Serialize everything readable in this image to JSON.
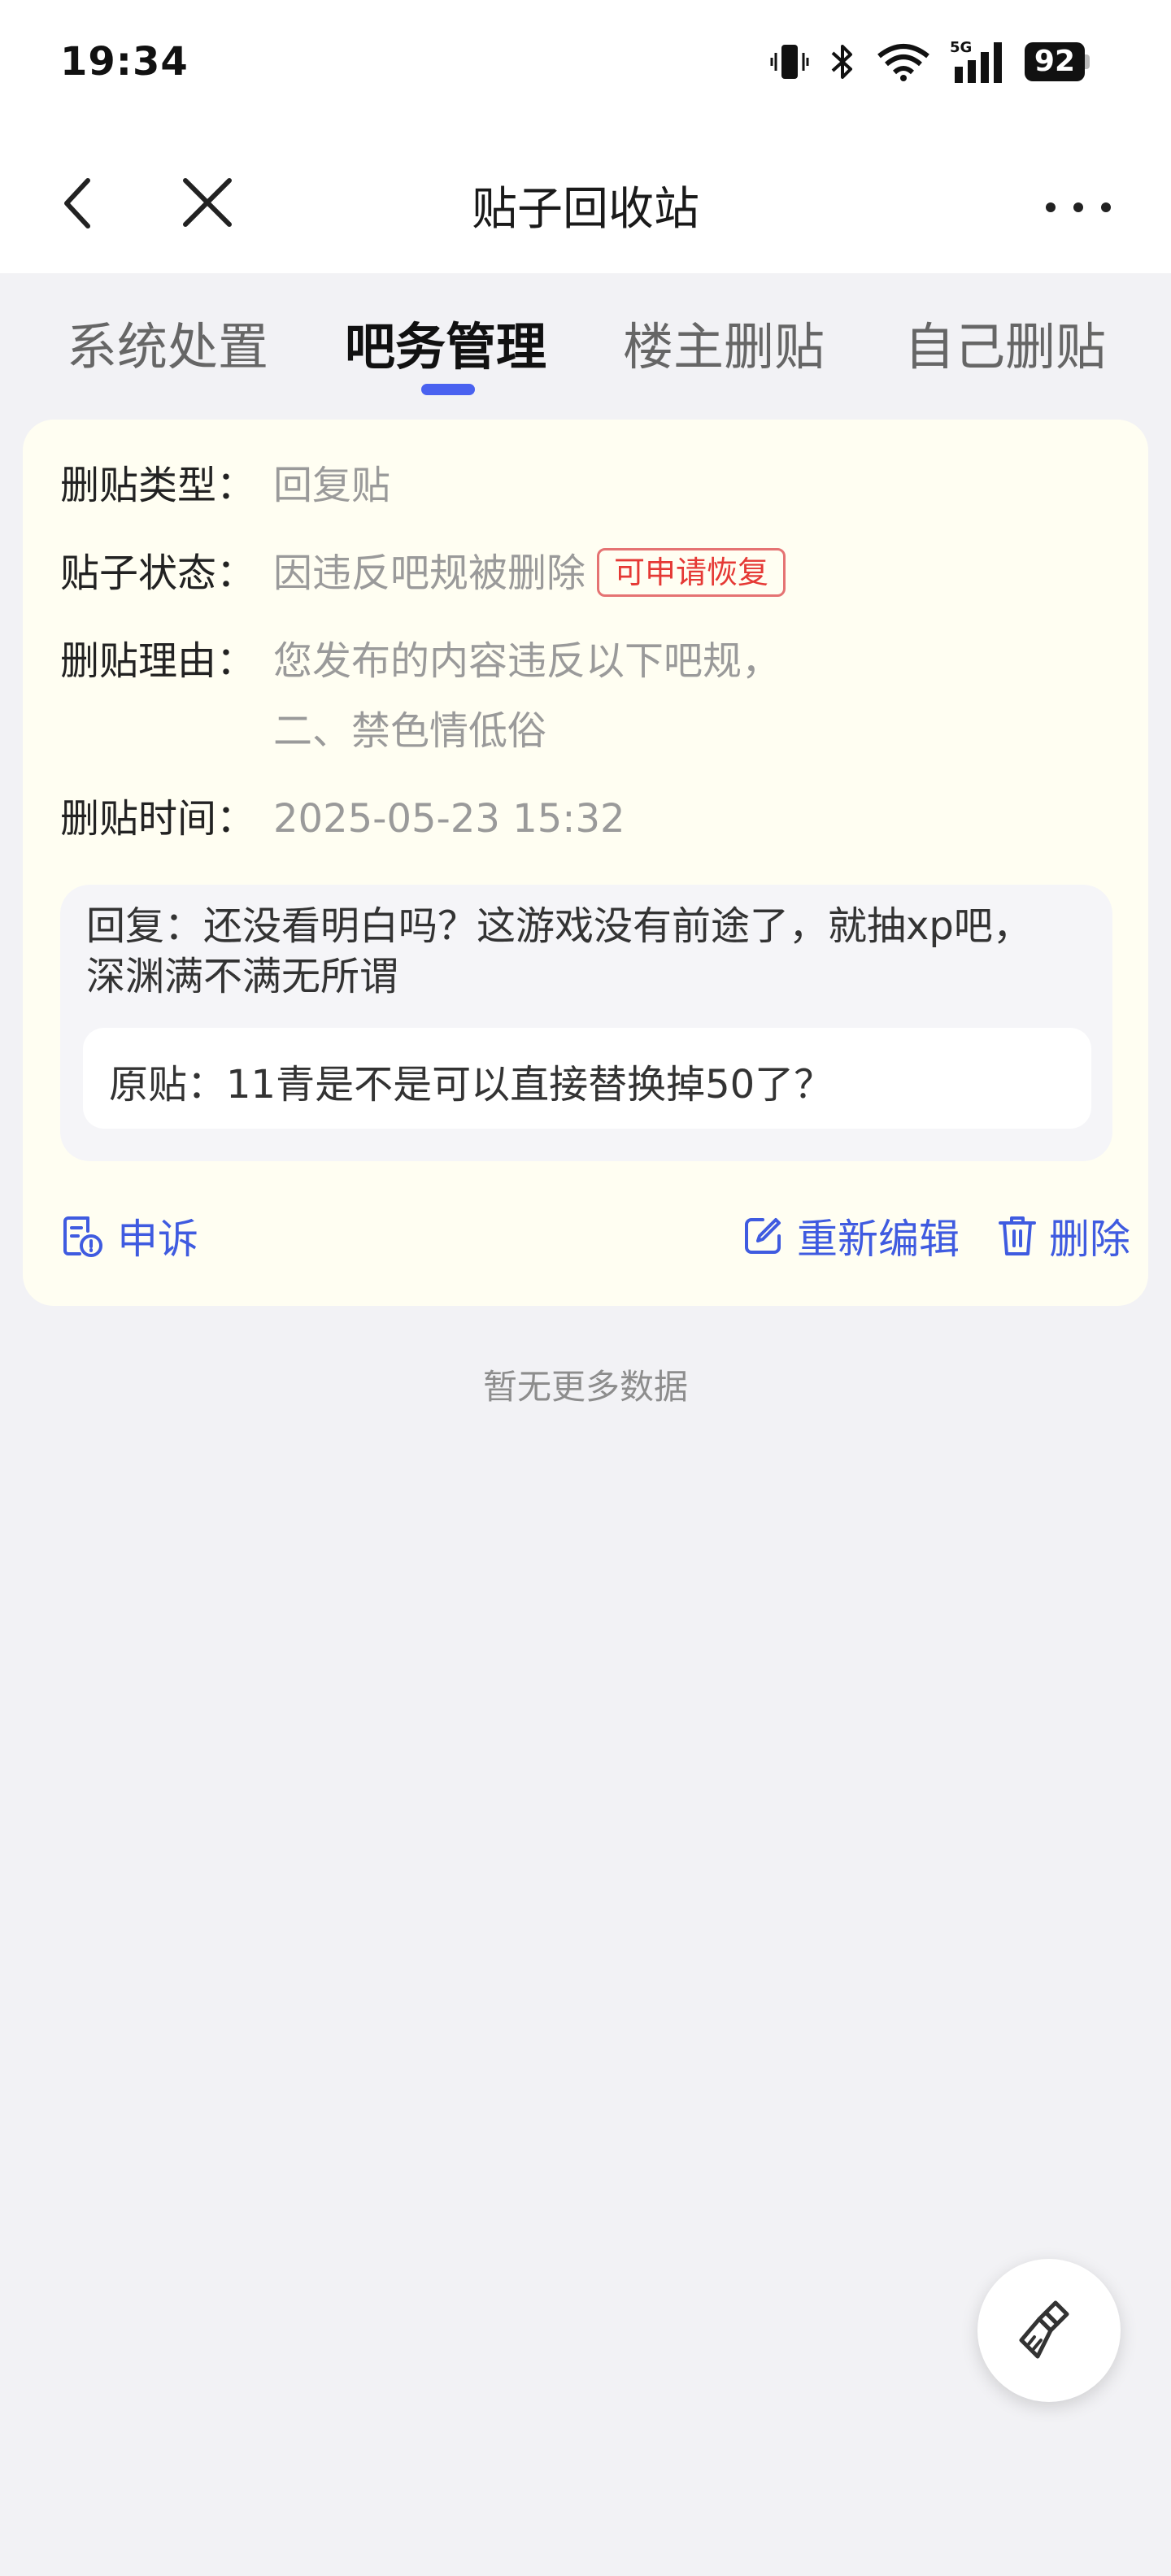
{
  "status_bar": {
    "time": "19:34",
    "battery": "92",
    "network": "5G"
  },
  "nav": {
    "title": "贴子回收站"
  },
  "tabs": [
    {
      "label": "系统处置"
    },
    {
      "label": "吧务管理"
    },
    {
      "label": "楼主删贴"
    },
    {
      "label": "自己删贴"
    }
  ],
  "active_tab": 1,
  "card": {
    "type_label": "删贴类型：",
    "type_value": "回复贴",
    "status_label": "贴子状态：",
    "status_value": "因违反吧规被删除",
    "status_badge": "可申请恢复",
    "reason_label": "删贴理由：",
    "reason_line1": "您发布的内容违反以下吧规，",
    "reason_line2": "二、禁色情低俗",
    "time_label": "删贴时间：",
    "time_value": "2025-05-23 15:32",
    "reply_text": "回复：还没看明白吗？这游戏没有前途了，就抽xp吧，深渊满不满无所谓",
    "original_text": "原贴：11青是不是可以直接替换掉50了？",
    "appeal_label": "申诉",
    "reedit_label": "重新编辑",
    "delete_label": "删除"
  },
  "no_more_text": "暂无更多数据",
  "colors": {
    "accent": "#3F5BE0",
    "badge": "#E53935",
    "card_bg": "#FFFEF2",
    "page_bg": "#F2F2F5"
  }
}
